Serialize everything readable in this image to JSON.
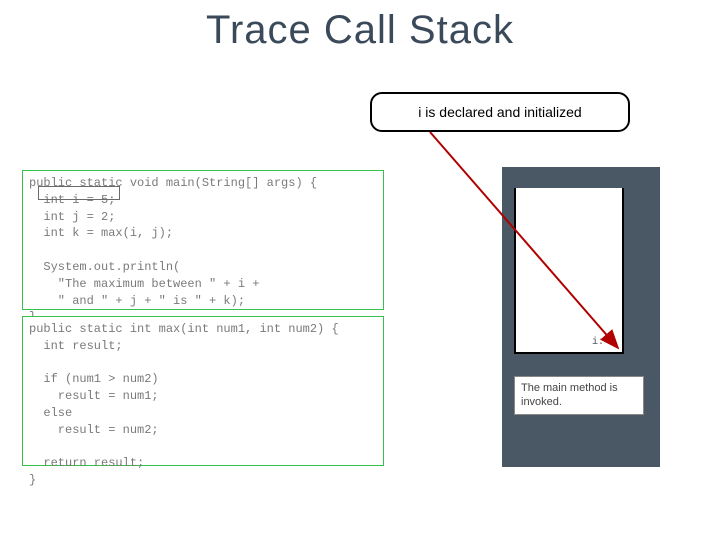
{
  "title": "Trace Call Stack",
  "bubble": "i is declared and initialized",
  "code_main": "public static void main(String[] args) {\n  int i = 5;\n  int j = 2;\n  int k = max(i, j);\n\n  System.out.println(\n    \"The maximum between \" + i +\n    \" and \" + j + \" is \" + k);\n}",
  "code_max": "public static int max(int num1, int num2) {\n  int result;\n\n  if (num1 > num2)\n    result = num1;\n  else\n    result = num2;\n\n  return result;\n}",
  "stack_var": "i: 5",
  "caption": "The main method is invoked."
}
